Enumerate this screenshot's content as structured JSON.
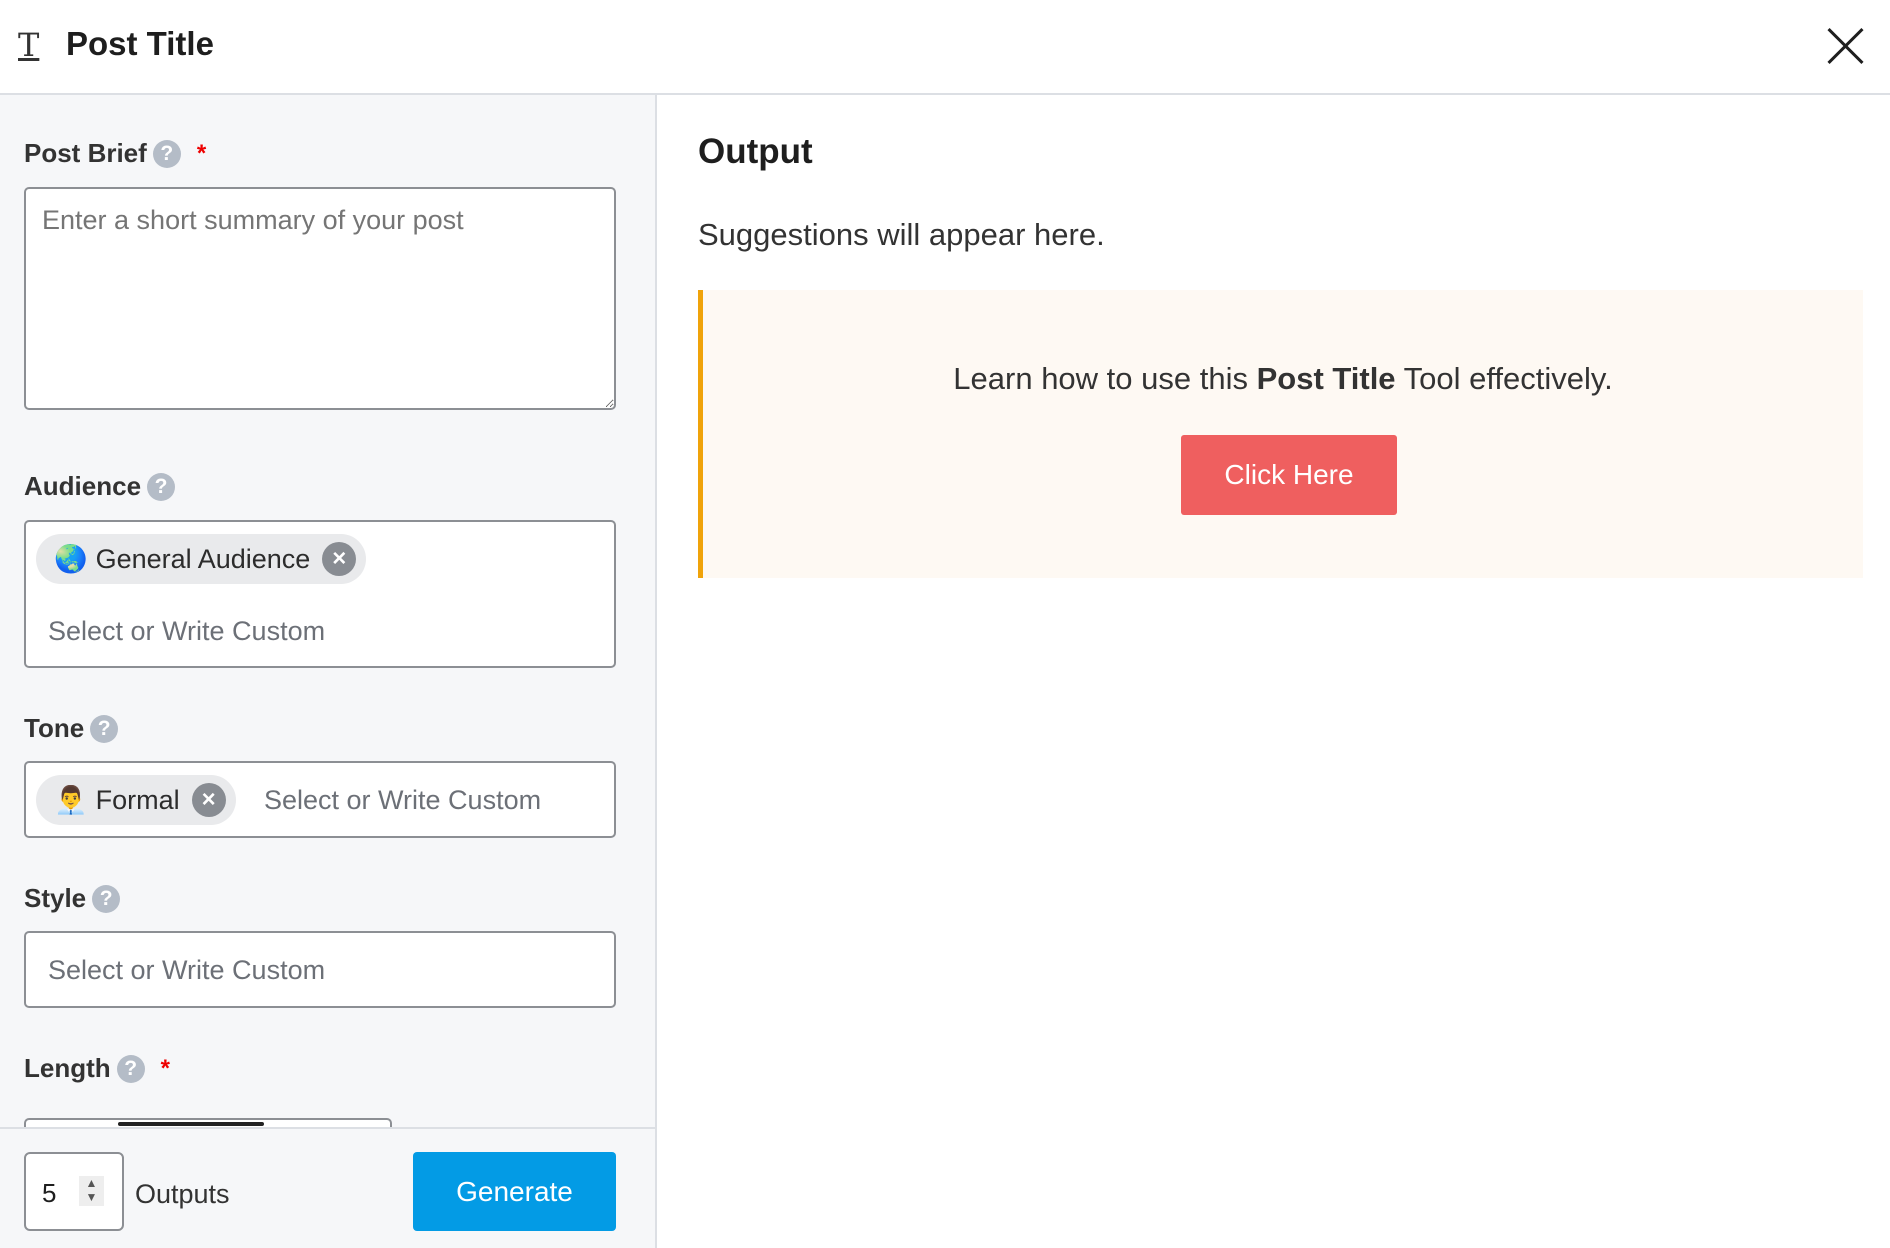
{
  "header": {
    "title": "Post Title",
    "title_icon": "text-T-icon",
    "close_icon": "close-icon"
  },
  "form": {
    "post_brief": {
      "label": "Post Brief",
      "required": "*",
      "placeholder": "Enter a short summary of your post"
    },
    "audience": {
      "label": "Audience",
      "chips": [
        {
          "emoji": "🌏",
          "label": "General Audience"
        }
      ],
      "placeholder": "Select or Write Custom"
    },
    "tone": {
      "label": "Tone",
      "chips": [
        {
          "emoji": "👨‍💼",
          "label": "Formal"
        }
      ],
      "placeholder": "Select or Write Custom"
    },
    "style": {
      "label": "Style",
      "placeholder": "Select or Write Custom"
    },
    "length": {
      "label": "Length",
      "required": "*"
    }
  },
  "footer": {
    "outputs_value": "5",
    "outputs_label": "Outputs",
    "generate_label": "Generate"
  },
  "output": {
    "heading": "Output",
    "empty_text": "Suggestions will appear here.",
    "notice": {
      "pre": "Learn how to use this ",
      "bold": "Post Title",
      "post": " Tool effectively.",
      "button": "Click Here"
    }
  },
  "colors": {
    "primary": "#039be5",
    "cta": "#ef5f5f",
    "notice_border": "#f0a30a",
    "required": "#ee0000"
  }
}
